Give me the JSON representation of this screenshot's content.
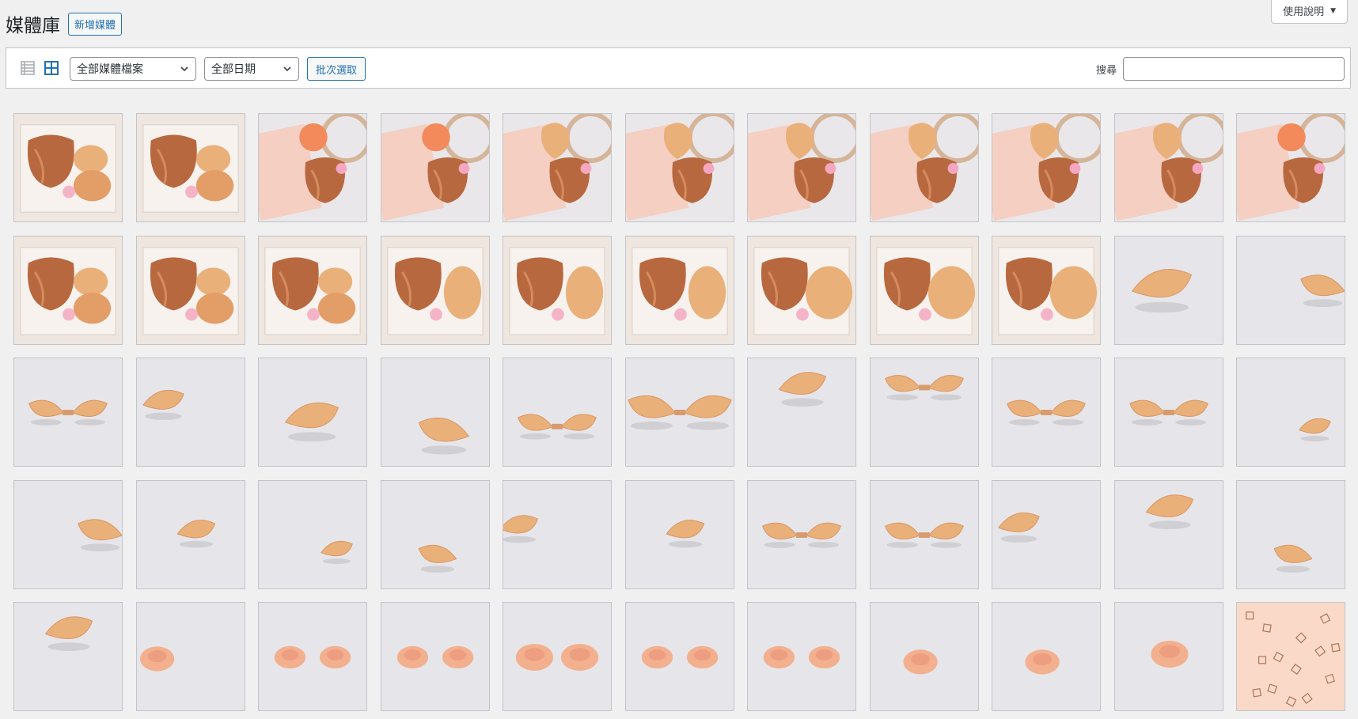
{
  "header": {
    "title": "媒體庫",
    "add_new": "新增媒體"
  },
  "help": {
    "label": "使用說明"
  },
  "toolbar": {
    "filter_type": "全部媒體檔案",
    "filter_date": "全部日期",
    "bulk_select": "批次選取",
    "search_label": "搜尋"
  },
  "colors": {
    "accent": "#2271b1",
    "background": "#f0f0f1",
    "border": "#c3c4c7",
    "satin": "#b8683f",
    "silicone": "#eab07a",
    "box_pink": "#f4cfc2",
    "studio_grey": "#e6e6ea"
  },
  "media": [
    {
      "kind": "box",
      "variant": "2pads-top"
    },
    {
      "kind": "box",
      "variant": "2pads"
    },
    {
      "kind": "flatlay",
      "variant": "ball"
    },
    {
      "kind": "flatlay",
      "variant": "ball-card"
    },
    {
      "kind": "flatlay",
      "variant": "heart-bag"
    },
    {
      "kind": "flatlay",
      "variant": "heart-bag-2"
    },
    {
      "kind": "flatlay",
      "variant": "heart-bag-3"
    },
    {
      "kind": "flatlay",
      "variant": "heart-card"
    },
    {
      "kind": "flatlay",
      "variant": "heart-card-2"
    },
    {
      "kind": "flatlay",
      "variant": "heart-card-3"
    },
    {
      "kind": "flatlay",
      "variant": "ball-card-2"
    },
    {
      "kind": "box",
      "variant": "2pads-top"
    },
    {
      "kind": "box",
      "variant": "2pads"
    },
    {
      "kind": "box",
      "variant": "2pads-2"
    },
    {
      "kind": "box",
      "variant": "pad-side"
    },
    {
      "kind": "box",
      "variant": "pad-side-2"
    },
    {
      "kind": "box",
      "variant": "pad-side-3"
    },
    {
      "kind": "box",
      "variant": "pad-big"
    },
    {
      "kind": "box",
      "variant": "pad-big-2"
    },
    {
      "kind": "box",
      "variant": "pad-big-3"
    },
    {
      "kind": "studio",
      "variant": "cup-big"
    },
    {
      "kind": "studio",
      "variant": "cup-right"
    },
    {
      "kind": "studio",
      "variant": "bra-left"
    },
    {
      "kind": "studio",
      "variant": "cup-left"
    },
    {
      "kind": "studio",
      "variant": "cup-mid"
    },
    {
      "kind": "studio",
      "variant": "cup-bottom"
    },
    {
      "kind": "studio",
      "variant": "bra-center"
    },
    {
      "kind": "studio",
      "variant": "bra-wide"
    },
    {
      "kind": "studio",
      "variant": "cup-top"
    },
    {
      "kind": "studio",
      "variant": "bra-top"
    },
    {
      "kind": "studio",
      "variant": "bra-mid"
    },
    {
      "kind": "studio",
      "variant": "bra-mid-2"
    },
    {
      "kind": "studio",
      "variant": "cup-small"
    },
    {
      "kind": "studio",
      "variant": "cup-right"
    },
    {
      "kind": "studio",
      "variant": "cup-center"
    },
    {
      "kind": "studio",
      "variant": "cup-small"
    },
    {
      "kind": "studio",
      "variant": "cup-low"
    },
    {
      "kind": "studio",
      "variant": "cup-edge"
    },
    {
      "kind": "studio",
      "variant": "cup-center"
    },
    {
      "kind": "studio",
      "variant": "bra-left"
    },
    {
      "kind": "studio",
      "variant": "bra-mid"
    },
    {
      "kind": "studio",
      "variant": "cup-left"
    },
    {
      "kind": "studio",
      "variant": "cup-top"
    },
    {
      "kind": "studio",
      "variant": "cup-low"
    },
    {
      "kind": "studio",
      "variant": "cup-top"
    },
    {
      "kind": "nipple",
      "variant": "single-left"
    },
    {
      "kind": "nipple",
      "variant": "pair"
    },
    {
      "kind": "nipple",
      "variant": "pair"
    },
    {
      "kind": "nipple",
      "variant": "pair-big"
    },
    {
      "kind": "nipple",
      "variant": "pair"
    },
    {
      "kind": "nipple",
      "variant": "pair"
    },
    {
      "kind": "nipple",
      "variant": "single-low"
    },
    {
      "kind": "nipple",
      "variant": "single-low"
    },
    {
      "kind": "nipple",
      "variant": "single-center"
    },
    {
      "kind": "pattern",
      "variant": "icons"
    }
  ]
}
